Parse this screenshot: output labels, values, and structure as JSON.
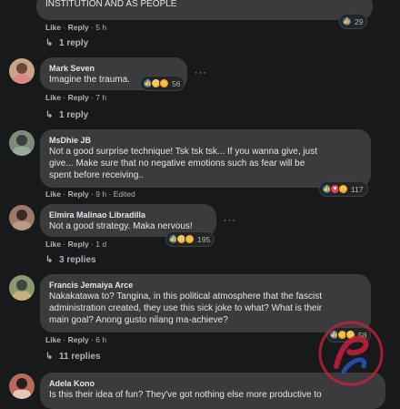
{
  "comments": [
    {
      "text_lines": [
        "INSTITUTION AND AS PEOPLE"
      ],
      "like": "Like",
      "reply": "Reply",
      "time": "5 h",
      "reaction_count": "29",
      "replies_label": "1 reply"
    },
    {
      "author": "Mark Seven",
      "text_lines": [
        "Imagine the trauma."
      ],
      "like": "Like",
      "reply": "Reply",
      "time": "7 h",
      "reaction_count": "56",
      "replies_label": "1 reply"
    },
    {
      "author": "MsDhie JB",
      "text_lines": [
        "Not a good surprise technique! Tsk tsk tsk... If you wanna give, just",
        "give... Make sure that no negative emotions such as fear will be",
        "spent before receiving.."
      ],
      "like": "Like",
      "reply": "Reply",
      "time": "9 h",
      "edited": "Edited",
      "reaction_count": "117"
    },
    {
      "author": "Elmira Malinao Libradilla",
      "text_lines": [
        "Not a good strategy. Maka nervous!"
      ],
      "like": "Like",
      "reply": "Reply",
      "time": "1 d",
      "reaction_count": "195",
      "replies_label": "3 replies"
    },
    {
      "author": "Francis Jemaiya Arce",
      "text_lines": [
        "Nakakatawa to? Tangina, in this political atmosphere that the fascist",
        "administration created, they use this sick joke to what? What is their",
        "main goal? Anong gusto nilang ma-achieve?"
      ],
      "like": "Like",
      "reply": "Reply",
      "time": "6 h",
      "reaction_count": "58",
      "replies_label": "11 replies"
    },
    {
      "author": "Adela Kono",
      "text_lines": [
        "Is this their idea of fun? They've got nothing else more productive to"
      ]
    }
  ],
  "icons": {
    "like": "thumbs-up",
    "love": "heart",
    "haha": "laughing-face",
    "sad": "sad-face",
    "more": "more-options",
    "reply_arrow": "reply-arrow"
  },
  "colors": {
    "background": "#18191a",
    "bubble": "#3a3b3c",
    "like_blue": "#1877f2",
    "love_red": "#f33e58",
    "face_yellow": "#f7b125"
  }
}
